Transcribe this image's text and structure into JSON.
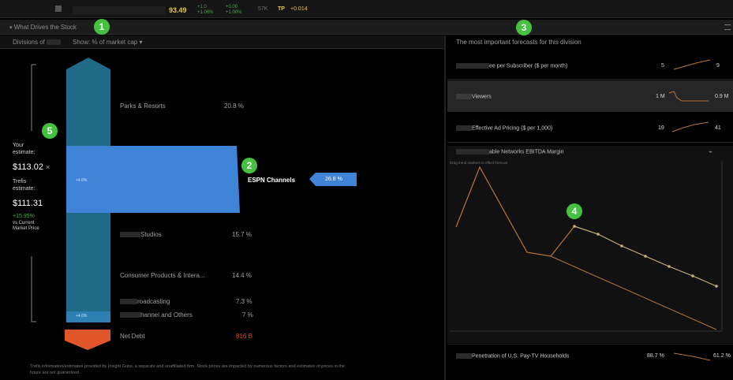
{
  "top_bar": {
    "price": "93.49",
    "change_a": "+1.0",
    "change_b": "+1.06%",
    "change_c": "+0.00",
    "change_d": "+1.00%",
    "volume": "57K",
    "ticker_icon": "TP",
    "ticker_value": "+0.014"
  },
  "section": {
    "title": "What Drives the Stock",
    "collapse_icon": "chevron-down-icon"
  },
  "left": {
    "divisions_label": "Divisions of",
    "show_dropdown": "Show: % of market cap",
    "estimates": {
      "your_label": "Your estimate:",
      "your_value": "$113.02",
      "close_glyph": "×",
      "trefis_label": "Trefis estimate:",
      "trefis_value": "$111.31",
      "diff_value": "+15.95%",
      "diff_label": "vs Current Market Price"
    },
    "divisions": [
      {
        "label": "Parks & Resorts",
        "pct": "20.8 %"
      },
      {
        "label": "ESPN Channels",
        "pct": "26.8 %"
      },
      {
        "label": "Studios",
        "pct": "15.7 %"
      },
      {
        "label": "Consumer Products & Intera...",
        "pct": "14.4 %"
      },
      {
        "label": "roadcasting",
        "pct": "7.3 %"
      },
      {
        "label": "hannel and Others",
        "pct": "7 %"
      },
      {
        "label": "Net Debt",
        "pct": "816 B"
      }
    ],
    "bar_notes": [
      "+4.6%",
      "+4.6%"
    ],
    "footnote": "Trefis information/estimates provided by Insight Guns, a separate and unaffiliated firm. Stock prices are impacted by numerous factors and estimates of prices in the future are not guaranteed."
  },
  "right": {
    "header": "The most important forecasts for this division",
    "forecasts": [
      {
        "label": "ee per Subscriber ($ per month)",
        "start": "5",
        "end": "9"
      },
      {
        "label": "Viewers",
        "start": "1 M",
        "end": "0.9 M"
      },
      {
        "label": "Effective Ad Pricing ($ per 1,000)",
        "start": "19",
        "end": "41"
      }
    ],
    "chart_title": "able Networks EBITDA Margin",
    "chart_subtitle": "Drag trend markers to effect forecast",
    "bottom_forecast": {
      "label": "Penetration of U.S. Pay-TV Households",
      "start": "88.7 %",
      "end": "61.2 %"
    }
  },
  "badges": [
    "1",
    "2",
    "3",
    "4",
    "5"
  ],
  "colors": {
    "bar_teal": "#1f6a86",
    "bar_blue": "#3f84d6",
    "debt_orange": "#e0552a",
    "badge_green": "#43c13f",
    "price_yellow": "#e9c44a",
    "line_orange": "#b5763a",
    "line_light": "#c6b07a"
  }
}
